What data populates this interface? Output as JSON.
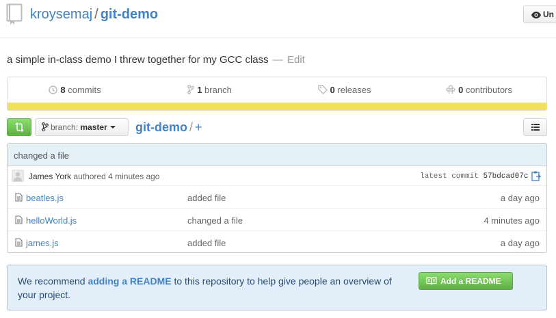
{
  "header": {
    "owner": "kroysemaj",
    "separator": "/",
    "repo": "git-demo",
    "watch_label": "Un"
  },
  "description": {
    "text": "a simple in-class demo I threw together for my GCC class",
    "dash": "—",
    "edit_label": "Edit"
  },
  "stats": {
    "commits": {
      "count": "8",
      "label": "commits"
    },
    "branches": {
      "count": "1",
      "label": "branch"
    },
    "releases": {
      "count": "0",
      "label": "releases"
    },
    "contributors": {
      "count": "0",
      "label": "contributors"
    },
    "language_color": "#f1e05a"
  },
  "file_nav": {
    "branch_prefix": "branch:",
    "branch_name": "master",
    "breadcrumb_repo": "git-demo",
    "breadcrumb_sep": "/",
    "add_file": "+"
  },
  "commit": {
    "message": "changed a file",
    "author": "James York",
    "authored_text": "authored 4 minutes ago",
    "latest_label": "latest commit",
    "sha": "57bdcad07c"
  },
  "files": [
    {
      "name": "beatles.js",
      "message": "added file",
      "age": "a day ago"
    },
    {
      "name": "helloWorld.js",
      "message": "changed a file",
      "age": "4 minutes ago"
    },
    {
      "name": "james.js",
      "message": "added file",
      "age": "a day ago"
    }
  ],
  "readme": {
    "text_before": "We recommend",
    "link_text": "adding a README",
    "text_after": "to this repository to help give people an overview of your project.",
    "button_label": "Add a README"
  },
  "colors": {
    "link": "#4183c4",
    "green_button": "#60b044",
    "commit_bg": "#e6f1f6",
    "readme_bg": "#e2eef9"
  }
}
